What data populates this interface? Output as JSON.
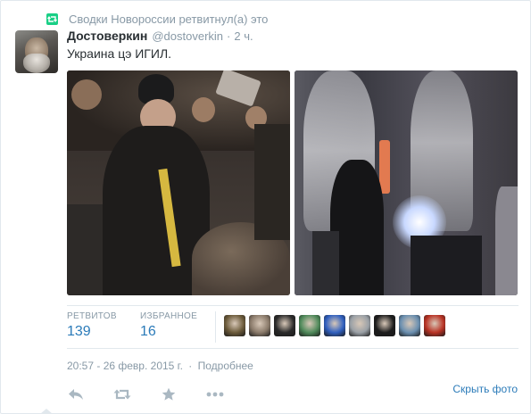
{
  "retweet": {
    "context": "Сводки Новороссии ретвитнул(а) это",
    "icon": "retweet-icon",
    "accent": "#19cf86"
  },
  "tweet": {
    "fullname": "Достоверкин",
    "username": "@dostoverkin",
    "separator": "·",
    "time": "2 ч.",
    "text": "Украина цэ ИГИЛ."
  },
  "stats": {
    "retweets_label": "РЕТВИТОВ",
    "retweets_value": "139",
    "favorites_label": "ИЗБРАННОЕ",
    "favorites_value": "16",
    "favoriter_avatars": [
      {
        "color": "#6b5a3a"
      },
      {
        "color": "#8a7a6a"
      },
      {
        "color": "#2a2a2a"
      },
      {
        "color": "#4f8a5a"
      },
      {
        "color": "#2f5fbf"
      },
      {
        "color": "#9aa0a6"
      },
      {
        "color": "#1c1c1c"
      },
      {
        "color": "#6a8fb0"
      },
      {
        "color": "#b83224"
      }
    ]
  },
  "timestamp": {
    "datetime": "20:57 - 26 февр. 2015 г.",
    "separator": "·",
    "details_link": "Подробнее"
  },
  "actions": {
    "reply_icon": "reply-icon",
    "retweet_icon": "retweet-icon",
    "favorite_icon": "star-icon",
    "more_icon": "more-icon",
    "hide_media": "Скрыть фото"
  },
  "colors": {
    "link": "#2b7bb9",
    "muted": "#8899a6",
    "text": "#292f33",
    "border": "#e1e8ed"
  }
}
